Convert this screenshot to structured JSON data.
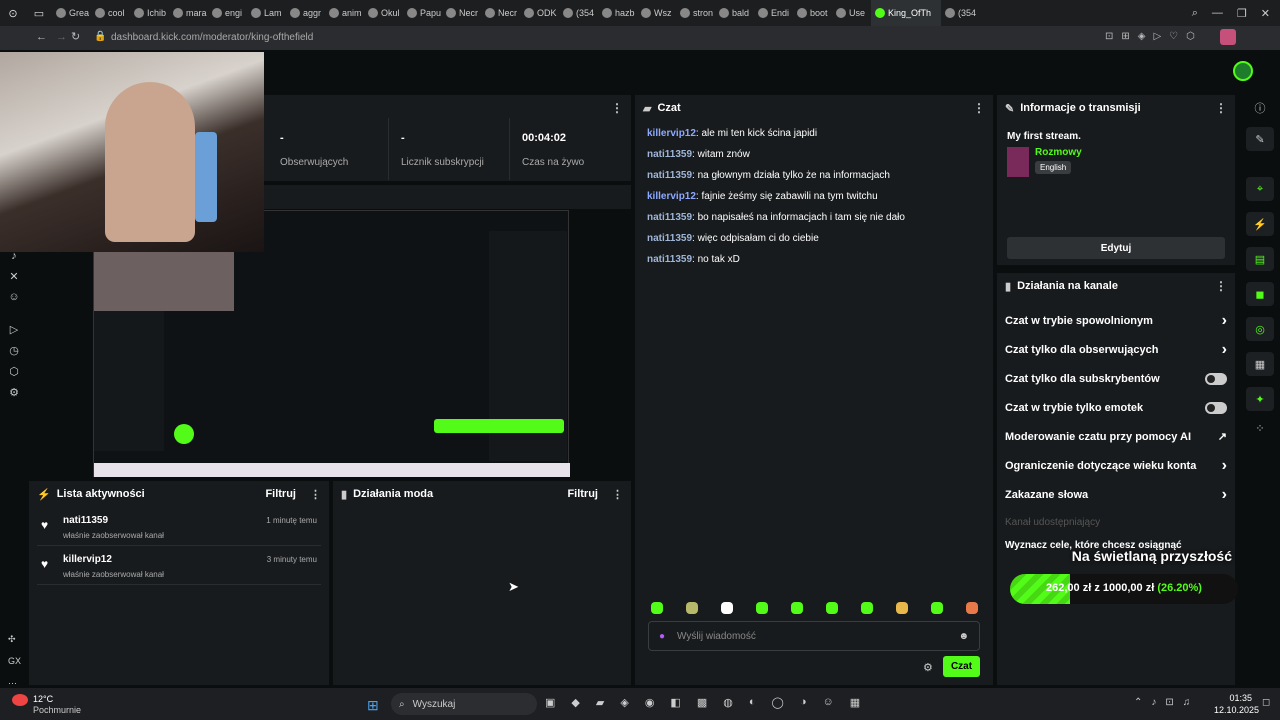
{
  "browser": {
    "tabs": [
      "Grea",
      "cool",
      "Ichib",
      "mara",
      "engi",
      "Lam",
      "aggr",
      "anim",
      "Okul",
      "Papu",
      "Necr",
      "Necr",
      "ODK",
      "(354",
      "hazb",
      "Wsz",
      "stron",
      "bald",
      "Endi",
      "boot",
      "Use",
      "King_OfTh",
      "(354"
    ],
    "url": "dashboard.kick.com/moderator/king-ofthefield"
  },
  "stats": [
    {
      "value": "-",
      "label": "Obserwujących"
    },
    {
      "value": "-",
      "label": "Licznik subskrypcji"
    },
    {
      "value": "00:04:02",
      "label": "Czas na żywo"
    }
  ],
  "chat": {
    "title": "Czat",
    "messages": [
      {
        "user": "killervip12",
        "text": ": ale mi ten kick ścina japidi",
        "color": "#8ea9ff"
      },
      {
        "user": "nati11359",
        "text": ": witam znów",
        "color": "#9fb6d9"
      },
      {
        "user": "nati11359",
        "text": ": na głownym działa tylko że na informacjach",
        "color": "#9fb6d9"
      },
      {
        "user": "killervip12",
        "text": ": fajnie żeśmy się zabawili na tym twitchu",
        "color": "#8ea9ff"
      },
      {
        "user": "nati11359",
        "text": ": bo napisałeś na informacjach i tam się nie dało",
        "color": "#9fb6d9"
      },
      {
        "user": "nati11359",
        "text": ": więc odpisałam ci do ciebie",
        "color": "#9fb6d9"
      },
      {
        "user": "nati11359",
        "text": ": no tak xD",
        "color": "#9fb6d9"
      }
    ],
    "input_placeholder": "Wyślij wiadomość",
    "send_label": "Czat"
  },
  "activity": {
    "title": "Lista aktywności",
    "filter": "Filtruj",
    "items": [
      {
        "user": "nati11359",
        "action": "właśnie zaobserwował kanał",
        "time": "1 minutę temu"
      },
      {
        "user": "killervip12",
        "action": "właśnie zaobserwował kanał",
        "time": "3 minuty temu"
      }
    ]
  },
  "modactions": {
    "title": "Działania moda",
    "filter": "Filtruj"
  },
  "streaminfo": {
    "title": "Informacje o transmisji",
    "stream_title": "My first stream.",
    "category": "Rozmowy",
    "language": "English",
    "edit": "Edytuj"
  },
  "channel": {
    "title": "Działania na kanale",
    "rows": [
      {
        "label": "Czat w trybie spowolnionym",
        "ctl": "chevron"
      },
      {
        "label": "Czat tylko dla obserwujących",
        "ctl": "chevron"
      },
      {
        "label": "Czat tylko dla subskrybentów",
        "ctl": "toggle"
      },
      {
        "label": "Czat w trybie tylko emotek",
        "ctl": "toggle"
      },
      {
        "label": "Moderowanie czatu przy pomocy AI",
        "ctl": "external"
      },
      {
        "label": "Ograniczenie dotyczące wieku konta",
        "ctl": "chevron"
      },
      {
        "label": "Zakazane słowa",
        "ctl": "chevron"
      }
    ],
    "shared": "Kanał udostępniający",
    "goal": "Wyznacz cele, które chcesz osiągnąć"
  },
  "overlay": {
    "title": "Na świetlaną przyszłość",
    "current": "262,00 zł",
    "sep": "z",
    "target": "1000,00 zł",
    "pct": "(26.20%)",
    "progress": 0.262
  },
  "taskbar": {
    "weather_temp": "12°C",
    "weather_desc": "Pochmurnie",
    "search": "Wyszukaj",
    "time": "01:35",
    "date": "12.10.2025"
  },
  "sidebar_left_text": "GX",
  "colors": {
    "accent": "#53fc18",
    "panel": "#181b1d"
  }
}
